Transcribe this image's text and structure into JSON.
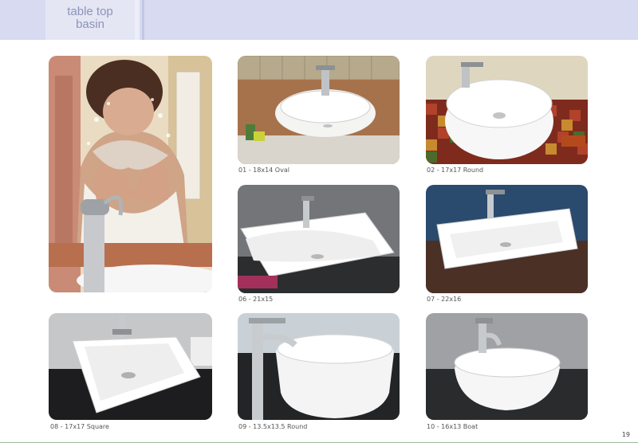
{
  "header": {
    "title_line1": "table top",
    "title_line2": "basin"
  },
  "products": [
    {
      "caption": "01 - 18x14 Oval"
    },
    {
      "caption": "02 - 17x17 Round"
    },
    {
      "caption": "06 - 21x15"
    },
    {
      "caption": "07 - 22x16"
    },
    {
      "caption": "08 - 17x17 Square"
    },
    {
      "caption": "09 - 13.5x13.5 Round"
    },
    {
      "caption": "10 - 16x13 Boat"
    }
  ],
  "footer": {
    "page_number": "19"
  }
}
